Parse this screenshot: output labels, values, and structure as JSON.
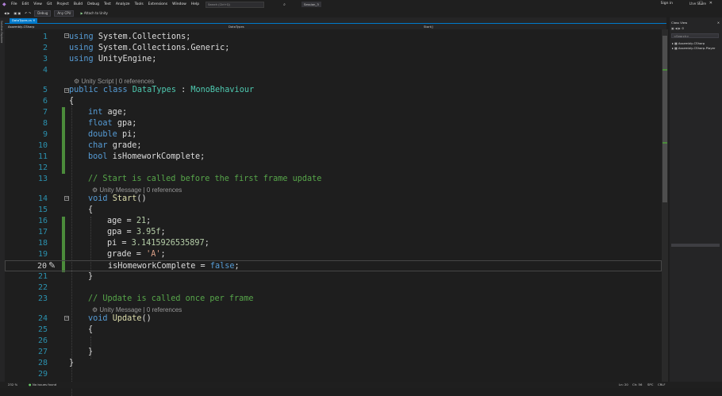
{
  "menu": [
    "File",
    "Edit",
    "View",
    "Git",
    "Project",
    "Build",
    "Debug",
    "Test",
    "Analyze",
    "Tools",
    "Extensions",
    "Window",
    "Help"
  ],
  "search_placeholder": "Search (Ctrl+Q)",
  "solution_name": "Session_3",
  "sign_in": "Sign in",
  "toolbar": {
    "config": "Debug",
    "platform": "Any CPU",
    "attach": "Attach to Unity"
  },
  "live_share": "Live Share",
  "left_strip": "Solution Explorer",
  "doc_tab": "DataTypes.cs",
  "nav": {
    "project": "Assembly-CSharp",
    "class": "DataTypes",
    "member": "Start()"
  },
  "codelens": {
    "class": "Unity Script | 0 references",
    "method": "Unity Message | 0 references"
  },
  "code": {
    "l1": "System.Collections;",
    "l2": "System.Collections.Generic;",
    "l3": "UnityEngine;",
    "class_name": "DataTypes",
    "base": "MonoBehaviour",
    "f_age": "age;",
    "f_gpa": "gpa;",
    "f_pi": "pi;",
    "f_grade": "grade;",
    "f_hw": "isHomeworkComplete;",
    "c1": "// Start is called before the first frame update",
    "a_age": "age = ",
    "v_age": "21",
    "a_gpa": "gpa = ",
    "v_gpa": "3.95f",
    "a_pi": "pi = ",
    "v_pi": "3.1415926535897",
    "a_grade": "grade = ",
    "v_grade": "'A'",
    "a_hw": "isHomeworkComplete = ",
    "v_hw": "false",
    "c2": "// Update is called once per frame"
  },
  "class_view": {
    "title": "Class View",
    "search": "<Search>",
    "item1": "Assembly-CSharp",
    "item2": "Assembly-CSharp-Player"
  },
  "status": {
    "zoom": "232 %",
    "issues": "No issues found",
    "position": "Ln: 20",
    "col": "Ch: 56",
    "spc": "SPC",
    "crlf": "CRLF"
  }
}
